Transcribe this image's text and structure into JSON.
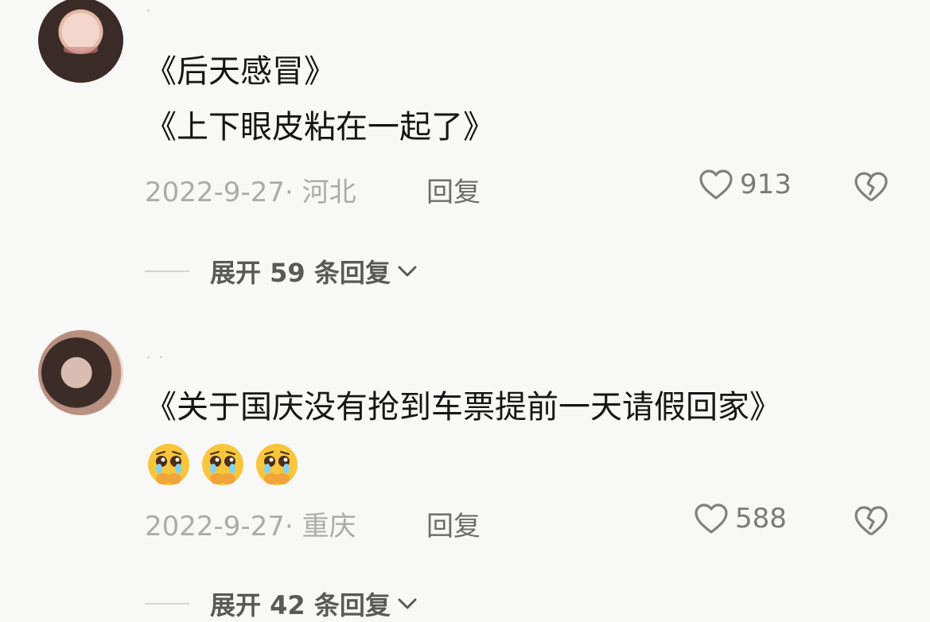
{
  "comments": [
    {
      "username": "·",
      "lines": [
        "《后天感冒》",
        "《上下眼皮粘在一起了》"
      ],
      "date_location": "2022-9-27· 河北",
      "reply_label": "回复",
      "likes": "913",
      "expand_label": "展开 59 条回复"
    },
    {
      "username": "· ·",
      "lines": [
        "《关于国庆没有抢到车票提前一天请假回家》"
      ],
      "emojis": [
        "pleading-face-emoji",
        "pleading-face-emoji",
        "pleading-face-emoji"
      ],
      "date_location": "2022-9-27· 重庆",
      "reply_label": "回复",
      "likes": "588",
      "expand_label": "展开 42 条回复"
    }
  ],
  "icons": {
    "like": "heart-outline-icon",
    "dislike": "broken-heart-icon",
    "expand": "chevron-down-icon"
  }
}
